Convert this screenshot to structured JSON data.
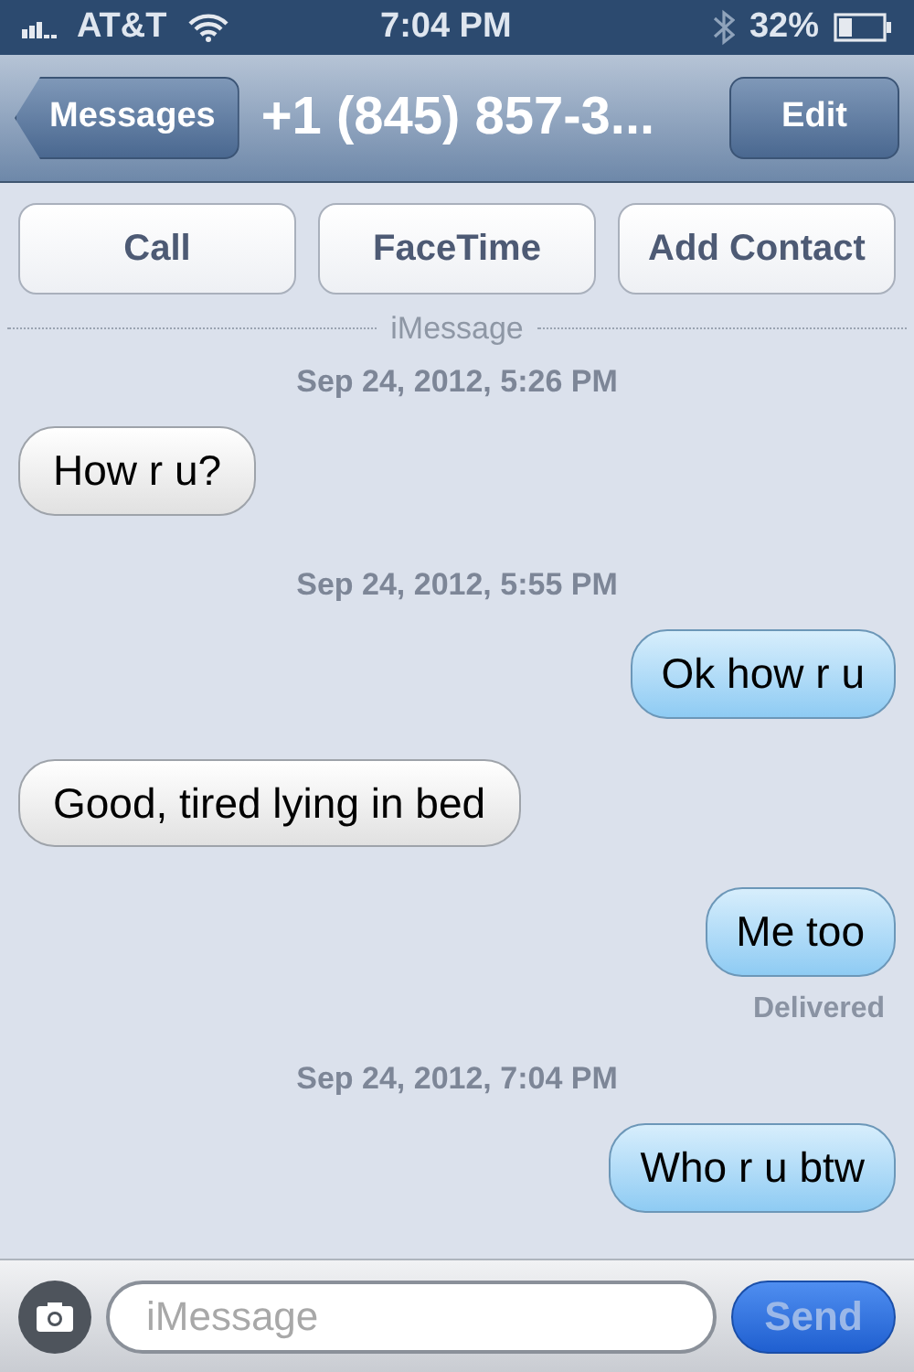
{
  "status_bar": {
    "carrier": "AT&T",
    "time": "7:04 PM",
    "battery": "32%"
  },
  "nav": {
    "back": "Messages",
    "title": "+1 (845) 857-3...",
    "edit": "Edit"
  },
  "actions": [
    "Call",
    "FaceTime",
    "Add Contact"
  ],
  "service_label": "iMessage",
  "messages": [
    {
      "kind": "timestamp",
      "text": "Sep 24, 2012, 5:26 PM"
    },
    {
      "kind": "received",
      "text": "How r u?"
    },
    {
      "kind": "timestamp",
      "text": "Sep 24, 2012, 5:55 PM"
    },
    {
      "kind": "sent",
      "text": "Ok how r u"
    },
    {
      "kind": "received",
      "text": "Good, tired lying in bed"
    },
    {
      "kind": "sent",
      "text": "Me too"
    },
    {
      "kind": "status",
      "text": "Delivered"
    },
    {
      "kind": "timestamp",
      "text": "Sep 24, 2012, 7:04 PM"
    },
    {
      "kind": "sent",
      "text": "Who r u btw"
    }
  ],
  "composer": {
    "placeholder": "iMessage",
    "send": "Send",
    "send_disabled": true
  }
}
